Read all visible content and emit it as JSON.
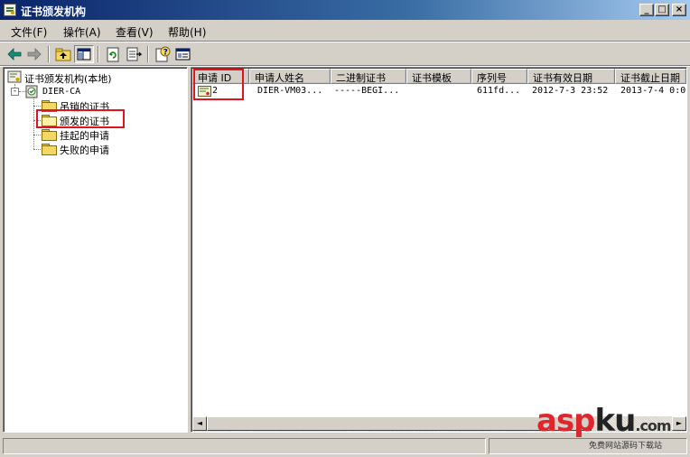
{
  "window": {
    "title": "证书颁发机构",
    "minimize_glyph": "_",
    "maximize_glyph": "□",
    "close_glyph": "×"
  },
  "menu": {
    "items": [
      {
        "label": "文件(F)"
      },
      {
        "label": "操作(A)"
      },
      {
        "label": "查看(V)"
      },
      {
        "label": "帮助(H)"
      }
    ]
  },
  "toolbar": {
    "buttons": [
      {
        "icon": "back-arrow-icon"
      },
      {
        "icon": "forward-arrow-icon"
      },
      {
        "icon": "up-one-level-icon"
      },
      {
        "icon": "show-hide-console-tree-icon"
      },
      {
        "icon": "refresh-icon"
      },
      {
        "icon": "export-list-icon"
      },
      {
        "icon": "help-icon"
      },
      {
        "icon": "properties-icon"
      }
    ],
    "accent_color": "#008000"
  },
  "tree": {
    "root": {
      "label": "证书颁发机构(本地)",
      "icon": "certificate-authority-icon"
    },
    "ca": {
      "label": "DIER-CA",
      "icon": "ca-server-icon",
      "expander": "-"
    },
    "folders": [
      {
        "label": "吊销的证书",
        "selected": false
      },
      {
        "label": "颁发的证书",
        "selected": true
      },
      {
        "label": "挂起的申请",
        "selected": false
      },
      {
        "label": "失败的申请",
        "selected": false
      }
    ]
  },
  "list": {
    "columns": [
      "申请 ID",
      "申请人姓名",
      "二进制证书",
      "证书模板",
      "序列号",
      "证书有效日期",
      "证书截止日期"
    ],
    "rows": [
      {
        "icon": "certificate-icon",
        "cells": [
          "2",
          "DIER-VM03...",
          "-----BEGI...",
          "",
          "611fd...",
          "2012-7-3 23:52",
          "2013-7-4 0:0"
        ]
      }
    ]
  },
  "scrollbar": {
    "left_arrow": "◄",
    "right_arrow": "►"
  },
  "highlight_color": "#e0141e",
  "watermark": {
    "brand_a": "asp",
    "brand_b": "ku",
    "domain_tld": ".com",
    "tagline": "免费网站源码下载站"
  }
}
